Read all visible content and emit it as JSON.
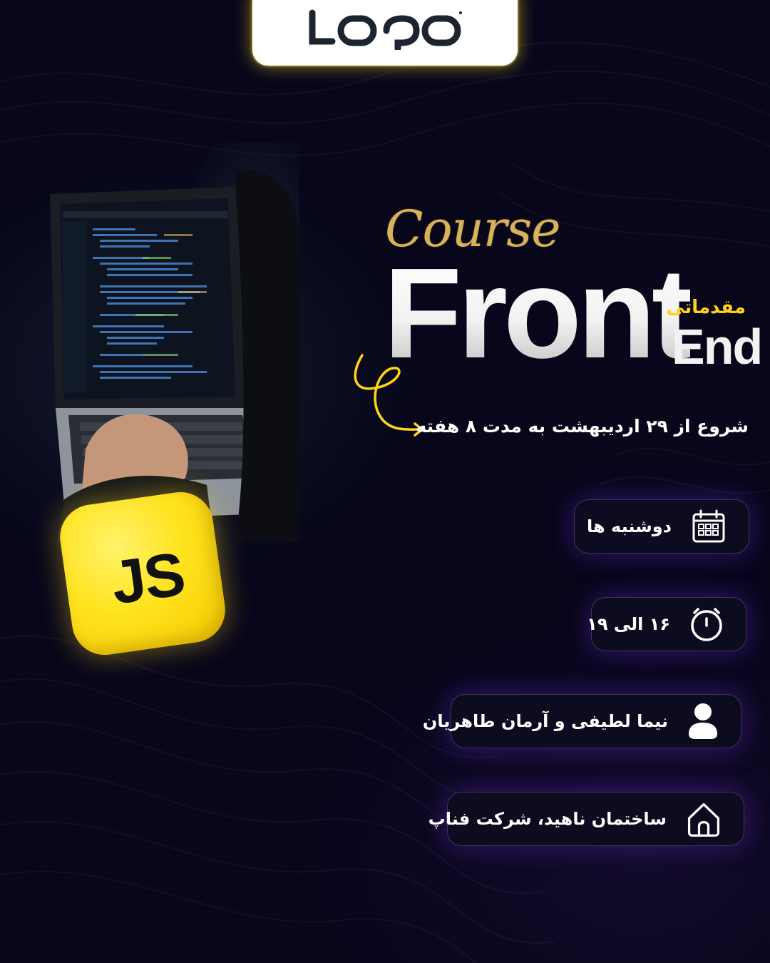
{
  "logo": {
    "text": "LOGO"
  },
  "badge": {
    "text": "JS",
    "color": "#ffe31f"
  },
  "headline": {
    "script": "Course",
    "main": "Front",
    "sub": "End",
    "tag": "مقدماتی"
  },
  "schedule_line": "شروع از ۲۹ اردیبهشت به مدت ۸ هفته",
  "info": [
    {
      "label": "دوشنبه ها",
      "icon": "calendar-icon"
    },
    {
      "label": "۱۶ الی ۱۹",
      "icon": "clock-icon"
    },
    {
      "label": "نیما لطیفی و آرمان طاهریان",
      "icon": "user-icon"
    },
    {
      "label": "ساختمان ناهید، شرکت فناپ",
      "icon": "home-icon"
    }
  ],
  "colors": {
    "accent_yellow": "#ffd21c",
    "glow_purple": "#6e28dc",
    "background": "#07061a"
  }
}
